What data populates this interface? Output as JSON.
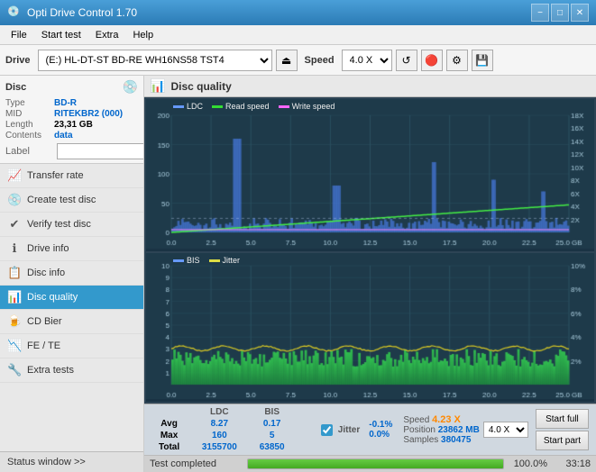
{
  "app": {
    "title": "Opti Drive Control 1.70",
    "icon": "💿"
  },
  "titlebar": {
    "minimize": "−",
    "maximize": "□",
    "close": "✕"
  },
  "menubar": {
    "items": [
      "File",
      "Start test",
      "Extra",
      "Help"
    ]
  },
  "toolbar": {
    "drive_label": "Drive",
    "drive_value": "(E:) HL-DT-ST BD-RE WH16NS58 TST4",
    "speed_label": "Speed",
    "speed_value": "4.0 X",
    "eject_icon": "⏏",
    "refresh_icon": "↻",
    "burn_icon": "🔴",
    "settings_icon": "⚙",
    "save_icon": "💾"
  },
  "disc": {
    "label": "Disc",
    "type_key": "Type",
    "type_val": "BD-R",
    "mid_key": "MID",
    "mid_val": "RITEKBR2 (000)",
    "length_key": "Length",
    "length_val": "23,31 GB",
    "contents_key": "Contents",
    "contents_val": "data",
    "label_key": "Label",
    "label_val": "",
    "label_placeholder": ""
  },
  "nav": {
    "items": [
      {
        "id": "transfer-rate",
        "label": "Transfer rate",
        "icon": "📈"
      },
      {
        "id": "create-test-disc",
        "label": "Create test disc",
        "icon": "💿"
      },
      {
        "id": "verify-test-disc",
        "label": "Verify test disc",
        "icon": "✔"
      },
      {
        "id": "drive-info",
        "label": "Drive info",
        "icon": "ℹ"
      },
      {
        "id": "disc-info",
        "label": "Disc info",
        "icon": "📋"
      },
      {
        "id": "disc-quality",
        "label": "Disc quality",
        "icon": "📊",
        "active": true
      },
      {
        "id": "cd-bier",
        "label": "CD Bier",
        "icon": "🍺"
      },
      {
        "id": "fe-te",
        "label": "FE / TE",
        "icon": "📉"
      },
      {
        "id": "extra-tests",
        "label": "Extra tests",
        "icon": "🔧"
      }
    ],
    "status_label": "Status window >>"
  },
  "disc_quality": {
    "title": "Disc quality",
    "legend_top": {
      "ldc": "LDC",
      "read": "Read speed",
      "write": "Write speed"
    },
    "legend_bottom": {
      "bis": "BIS",
      "jitter": "Jitter"
    }
  },
  "stats": {
    "columns": [
      "",
      "LDC",
      "BIS",
      "",
      "Jitter",
      "Speed",
      ""
    ],
    "avg_label": "Avg",
    "avg_ldc": "8.27",
    "avg_bis": "0.17",
    "avg_jitter": "-0.1%",
    "max_label": "Max",
    "max_ldc": "160",
    "max_bis": "5",
    "max_jitter": "0.0%",
    "total_label": "Total",
    "total_ldc": "3155700",
    "total_bis": "63850",
    "speed_label": "Speed",
    "speed_val": "4.23 X",
    "speed_select": "4.0 X",
    "position_label": "Position",
    "position_val": "23862 MB",
    "samples_label": "Samples",
    "samples_val": "380475",
    "jitter_checked": true,
    "jitter_label": "Jitter"
  },
  "actions": {
    "start_full": "Start full",
    "start_part": "Start part"
  },
  "progress": {
    "status_text": "Test completed",
    "percent": "100.0%",
    "time": "33:18",
    "fill_width": "100"
  }
}
